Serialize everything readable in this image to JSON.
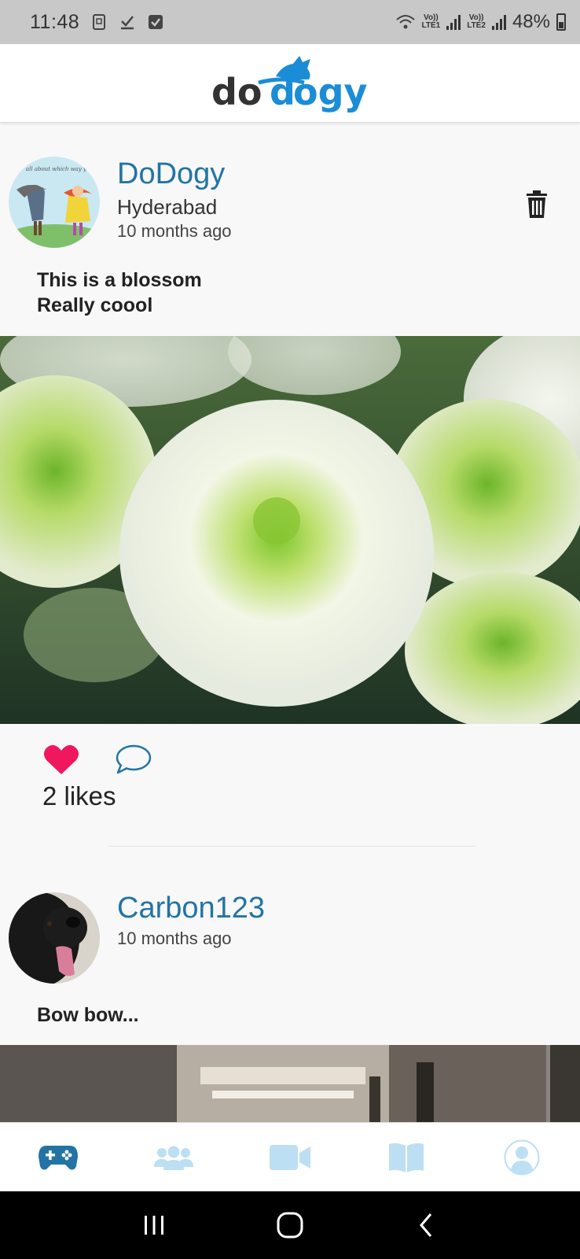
{
  "status_bar": {
    "time": "11:48",
    "net1": "Vo))\nLTE1",
    "net2": "Vo))\nLTE2",
    "battery": "48%"
  },
  "app": {
    "logo_text": "dodogy",
    "brand_color": "#2274a5"
  },
  "posts": [
    {
      "user": "DoDogy",
      "location": "Hyderabad",
      "time": "10 months ago",
      "text_line1": "This is a blossom",
      "text_line2": "Really coool",
      "likes": "2 likes",
      "avatar_caption": "all about which way you"
    },
    {
      "user": "Carbon123",
      "time": "10 months ago",
      "text_line1": "Bow bow..."
    }
  ],
  "icons": {
    "delete": "trash-icon",
    "like": "heart-icon",
    "comment": "comment-icon",
    "nav": [
      "gamepad-icon",
      "users-icon",
      "video-icon",
      "book-icon",
      "profile-icon"
    ]
  },
  "colors": {
    "heart": "#f0175e",
    "nav_active": "#2274a5",
    "nav_inactive": "#bcdff3"
  }
}
